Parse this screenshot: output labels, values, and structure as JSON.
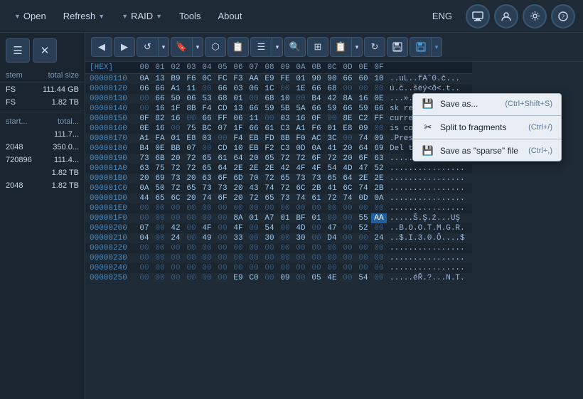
{
  "menuBar": {
    "items": [
      {
        "label": "Open",
        "hasArrow": true,
        "id": "open"
      },
      {
        "label": "Refresh",
        "hasArrow": true,
        "id": "refresh"
      },
      {
        "label": "RAID",
        "hasArrow": true,
        "id": "raid"
      },
      {
        "label": "Tools",
        "hasArrow": false,
        "id": "tools"
      },
      {
        "label": "About",
        "hasArrow": false,
        "id": "about"
      }
    ],
    "lang": "ENG"
  },
  "sidebar": {
    "colHeaders": [
      "stem",
      "total size"
    ],
    "rows": [
      {
        "stem": "FS",
        "totalSize": "111.44 GB"
      },
      {
        "stem": "FS",
        "totalSize": "1.82 TB"
      },
      {
        "stem": "",
        "totalSize": ""
      },
      {
        "stem": "start...",
        "totalSize": "total..."
      },
      {
        "stem": "",
        "totalSize": "111.7..."
      },
      {
        "stem": "2048",
        "totalSize": "350.0..."
      },
      {
        "stem": "720896",
        "totalSize": "111.4..."
      },
      {
        "stem": "",
        "totalSize": "1.82 TB"
      },
      {
        "stem": "2048",
        "totalSize": "1.82 TB"
      }
    ]
  },
  "toolbar": {
    "buttons": [
      "◀",
      "▶",
      "↺",
      "🔖",
      "⬡",
      "📋",
      "☰",
      "🔍",
      "⊞",
      "📋2",
      "↻",
      "💾",
      "💾2"
    ]
  },
  "hexTable": {
    "hexHeader": "[HEX]",
    "colHeaders": [
      "00",
      "01",
      "02",
      "03",
      "04",
      "05",
      "06",
      "07",
      "08",
      "09",
      "0A",
      "0B",
      "0C",
      "0D",
      "0E",
      "0F"
    ],
    "rows": [
      {
        "addr": "00000110",
        "bytes": [
          "0A",
          "13",
          "B9",
          "F6",
          "0C",
          "FC",
          "F3",
          "AA",
          "E9",
          "FE",
          "01",
          "90",
          "90",
          "66",
          "60",
          "10"
        ],
        "text": "..uL..fAˆ0.č..."
      },
      {
        "addr": "00000120",
        "bytes": [
          "06",
          "66",
          "A1",
          "11",
          "00",
          "66",
          "03",
          "06",
          "1C",
          "00",
          "1E",
          "66",
          "68",
          "00",
          "00",
          "00"
        ],
        "text": "ú.č..šëÿ<ð<.t.."
      },
      {
        "addr": "00000130",
        "bytes": [
          "00",
          "66",
          "50",
          "06",
          "53",
          "68",
          "01",
          "00",
          "68",
          "10",
          "00",
          "B4",
          "42",
          "8A",
          "16",
          "0E"
        ],
        "text": "...»..Ĩ.ešÃ..A.."
      },
      {
        "addr": "00000140",
        "bytes": [
          "00",
          "16",
          "1F",
          "8B",
          "F4",
          "CD",
          "13",
          "66",
          "59",
          "5B",
          "5A",
          "66",
          "59",
          "66",
          "59",
          "66"
        ],
        "text": "sk read error oc"
      },
      {
        "addr": "00000150",
        "bytes": [
          "0F",
          "82",
          "16",
          "00",
          "66",
          "FF",
          "06",
          "11",
          "00",
          "03",
          "16",
          "0F",
          "00",
          "8E",
          "C2",
          "FF"
        ],
        "text": "curred...BOOTMGR"
      },
      {
        "addr": "00000160",
        "bytes": [
          "0E",
          "16",
          "00",
          "75",
          "BC",
          "07",
          "1F",
          "66",
          "61",
          "C3",
          "A1",
          "F6",
          "01",
          "E8",
          "09",
          "00"
        ],
        "text": " is compressed.."
      },
      {
        "addr": "00000170",
        "bytes": [
          "A1",
          "FA",
          "01",
          "E8",
          "03",
          "00",
          "F4",
          "EB",
          "FD",
          "8B",
          "F0",
          "AC",
          "3C",
          "00",
          "74",
          "09"
        ],
        "text": ".Press Ctrl+Alt+"
      },
      {
        "addr": "00000180",
        "bytes": [
          "B4",
          "0E",
          "BB",
          "07",
          "00",
          "CD",
          "10",
          "EB",
          "F2",
          "C3",
          "0D",
          "0A",
          "41",
          "20",
          "64",
          "69"
        ],
        "text": "Del to restart.."
      },
      {
        "addr": "00000190",
        "bytes": [
          "73",
          "6B",
          "20",
          "72",
          "65",
          "61",
          "64",
          "20",
          "65",
          "72",
          "72",
          "6F",
          "72",
          "20",
          "6F",
          "63"
        ],
        "text": "................"
      },
      {
        "addr": "000001A0",
        "bytes": [
          "63",
          "75",
          "72",
          "72",
          "65",
          "64",
          "2E",
          "2E",
          "2E",
          "42",
          "4F",
          "4F",
          "54",
          "4D",
          "47",
          "52"
        ],
        "text": "................"
      },
      {
        "addr": "000001B0",
        "bytes": [
          "20",
          "69",
          "73",
          "20",
          "63",
          "6F",
          "6D",
          "70",
          "72",
          "65",
          "73",
          "73",
          "65",
          "64",
          "2E",
          "2E"
        ],
        "text": "................"
      },
      {
        "addr": "000001C0",
        "bytes": [
          "0A",
          "50",
          "72",
          "65",
          "73",
          "73",
          "20",
          "43",
          "74",
          "72",
          "6C",
          "2B",
          "41",
          "6C",
          "74",
          "2B"
        ],
        "text": "................"
      },
      {
        "addr": "000001D0",
        "bytes": [
          "44",
          "65",
          "6C",
          "20",
          "74",
          "6F",
          "20",
          "72",
          "65",
          "73",
          "74",
          "61",
          "72",
          "74",
          "0D",
          "0A"
        ],
        "text": "................"
      },
      {
        "addr": "000001E0",
        "bytes": [
          "00",
          "00",
          "00",
          "00",
          "00",
          "00",
          "00",
          "00",
          "00",
          "00",
          "00",
          "00",
          "00",
          "00",
          "00",
          "00"
        ],
        "text": "................"
      },
      {
        "addr": "000001F0",
        "bytes": [
          "00",
          "00",
          "00",
          "00",
          "00",
          "00",
          "8A",
          "01",
          "A7",
          "01",
          "BF",
          "01",
          "00",
          "00",
          "55",
          "AA"
        ],
        "text": ".....Š.Ş.ż...UŞ",
        "highlightLast": true
      },
      {
        "addr": "00000200",
        "bytes": [
          "07",
          "00",
          "42",
          "00",
          "4F",
          "00",
          "4F",
          "00",
          "54",
          "00",
          "4D",
          "00",
          "47",
          "00",
          "52",
          "00"
        ],
        "text": "..B.O.O.T.M.G.R."
      },
      {
        "addr": "00000210",
        "bytes": [
          "04",
          "00",
          "24",
          "00",
          "49",
          "00",
          "33",
          "00",
          "30",
          "00",
          "30",
          "00",
          "D4",
          "00",
          "00",
          "24"
        ],
        "text": "..$.I.3.0.Ô....$"
      },
      {
        "addr": "00000220",
        "bytes": [
          "00",
          "00",
          "00",
          "00",
          "00",
          "00",
          "00",
          "00",
          "00",
          "00",
          "00",
          "00",
          "00",
          "00",
          "00",
          "00"
        ],
        "text": "................"
      },
      {
        "addr": "00000230",
        "bytes": [
          "00",
          "00",
          "00",
          "00",
          "00",
          "00",
          "00",
          "00",
          "00",
          "00",
          "00",
          "00",
          "00",
          "00",
          "00",
          "00"
        ],
        "text": "................"
      },
      {
        "addr": "00000240",
        "bytes": [
          "00",
          "00",
          "00",
          "00",
          "00",
          "00",
          "00",
          "00",
          "00",
          "00",
          "00",
          "00",
          "00",
          "00",
          "00",
          "00"
        ],
        "text": "................"
      },
      {
        "addr": "00000250",
        "bytes": [
          "00",
          "00",
          "00",
          "00",
          "00",
          "00",
          "E9",
          "C0",
          "00",
          "09",
          "00",
          "05",
          "4E",
          "00",
          "54",
          "00"
        ],
        "text": ".....éŘ.?...N.T."
      }
    ]
  },
  "contextMenu": {
    "items": [
      {
        "label": "Save as...",
        "shortcut": "(Ctrl+Shift+S)",
        "icon": "💾",
        "id": "save-as"
      },
      {
        "label": "Split to fragments",
        "shortcut": "(Ctrl+/)",
        "icon": "✂",
        "id": "split"
      },
      {
        "label": "Save as \"sparse\" file",
        "shortcut": "(Ctrl+,)",
        "icon": "💾",
        "id": "save-sparse"
      }
    ]
  }
}
